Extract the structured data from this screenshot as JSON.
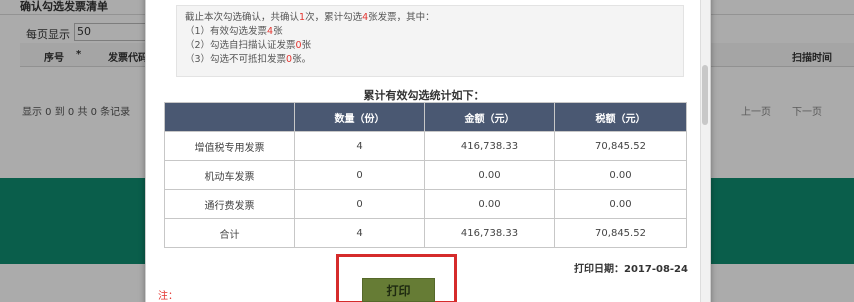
{
  "background": {
    "title": "确认勾选发票清单",
    "per_page_label": "每页显示",
    "per_page_value": "50",
    "columns": [
      "序号",
      "*",
      "发票代码",
      "扫描时间"
    ],
    "footer_text": "显示 0 到 0 共 0 条记录",
    "prev_label": "上一页",
    "next_label": "下一页"
  },
  "modal": {
    "summary": {
      "line1_prefix": "截止本次勾选确认，共确认",
      "line1_count": "1",
      "line1_mid": "次，累计勾选",
      "line1_num": "4",
      "line1_suffix": "张发票，其中：",
      "item1_prefix": "（1）有效勾选发票",
      "item1_num": "4",
      "item1_suffix": "张",
      "item2_prefix": "（2）勾选自扫描认证发票",
      "item2_num": "0",
      "item2_suffix": "张",
      "item3_prefix": "（3）勾选不可抵扣发票",
      "item3_num": "0",
      "item3_suffix": "张。"
    },
    "stats_title": "累计有效勾选统计如下：",
    "table": {
      "headers": [
        "",
        "数量（份）",
        "金额（元）",
        "税额（元）"
      ],
      "rows": [
        [
          "增值税专用发票",
          "4",
          "416,738.33",
          "70,845.52"
        ],
        [
          "机动车发票",
          "0",
          "0.00",
          "0.00"
        ],
        [
          "通行费发票",
          "0",
          "0.00",
          "0.00"
        ],
        [
          "合计",
          "4",
          "416,738.33",
          "70,845.52"
        ]
      ]
    },
    "print_date": "打印日期：2017-08-24",
    "print_button": "打印",
    "note": "注："
  }
}
